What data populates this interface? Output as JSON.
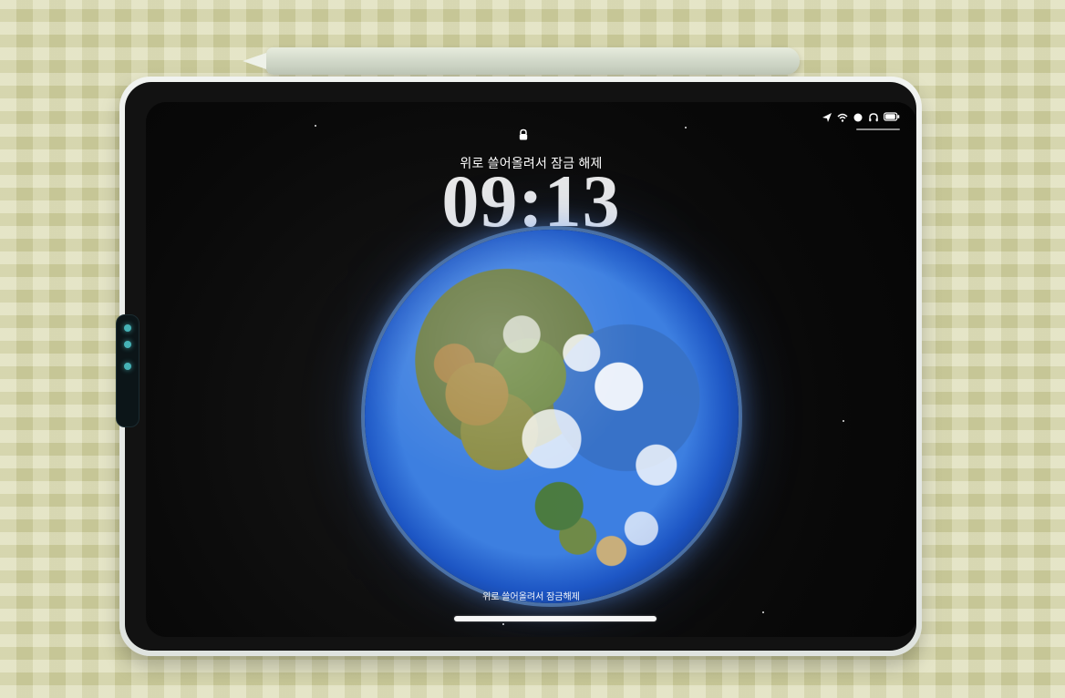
{
  "lock_screen": {
    "unlock_hint": "위로 쓸어올려서 잠금 해제",
    "time": "09:13",
    "bottom_hint": "위로 쓸어올려서 잠금해제"
  },
  "status_bar": {
    "icons": [
      "location-icon",
      "wifi-icon",
      "focus-icon",
      "headphones-icon",
      "battery-icon"
    ]
  }
}
